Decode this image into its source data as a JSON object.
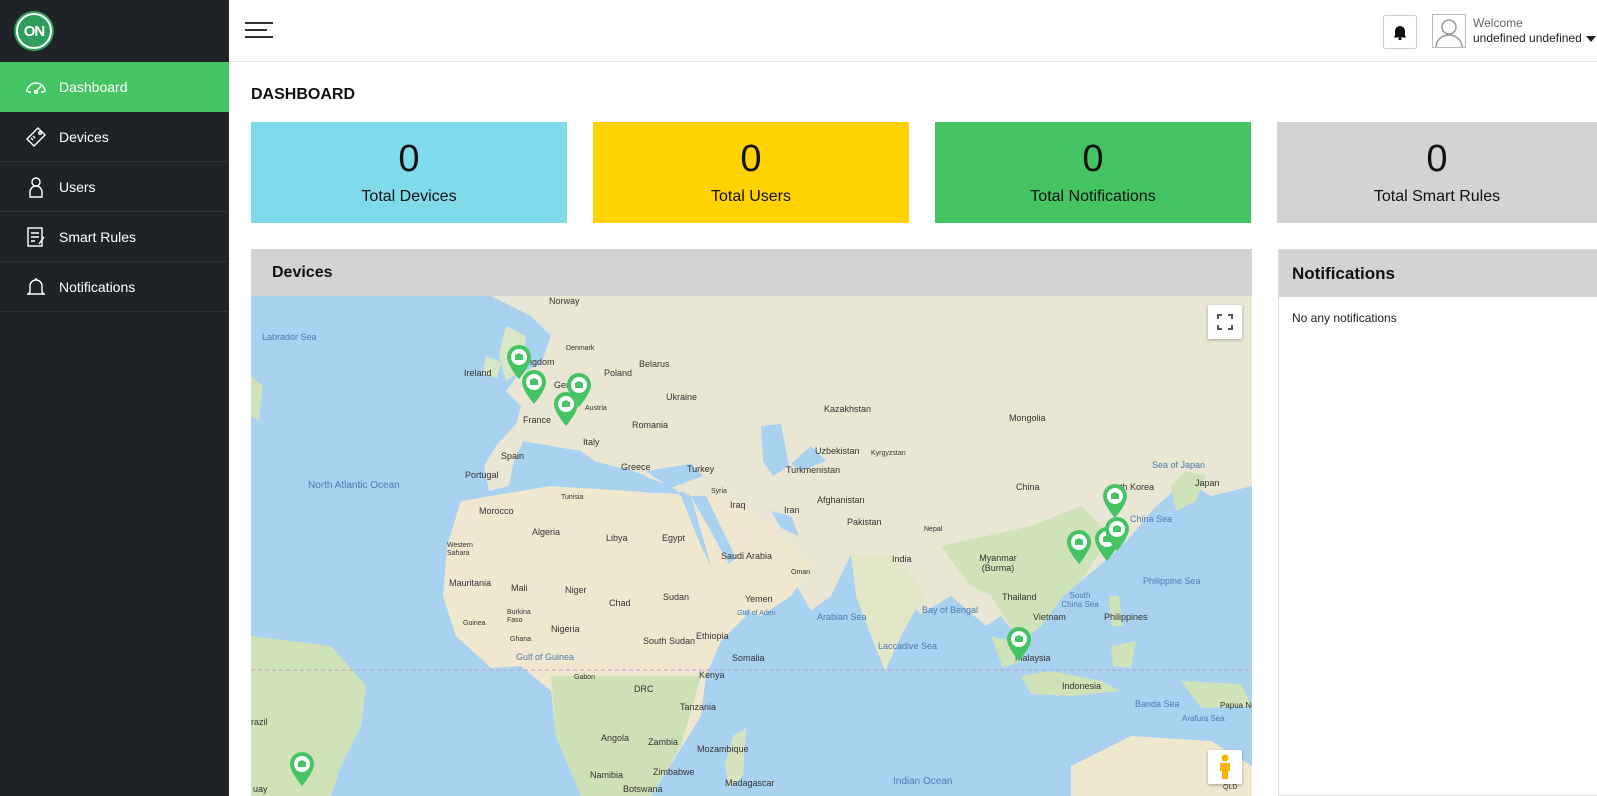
{
  "sidebar": {
    "logo_text": "ON",
    "items": [
      {
        "label": "Dashboard",
        "icon": "speedometer-icon",
        "active": true
      },
      {
        "label": "Devices",
        "icon": "tag-icon"
      },
      {
        "label": "Users",
        "icon": "user-icon"
      },
      {
        "label": "Smart Rules",
        "icon": "rules-icon"
      },
      {
        "label": "Notifications",
        "icon": "bell-icon"
      }
    ]
  },
  "header": {
    "welcome": "Welcome",
    "username": "undefined undefined"
  },
  "page": {
    "title": "DASHBOARD"
  },
  "stats": [
    {
      "value": "0",
      "label": "Total Devices",
      "color": "#7fdbea"
    },
    {
      "value": "0",
      "label": "Total Users",
      "color": "#ffd200"
    },
    {
      "value": "0",
      "label": "Total Notifications",
      "color": "#45c463"
    },
    {
      "value": "0",
      "label": "Total Smart Rules",
      "color": "#d3d3d3"
    }
  ],
  "devices_panel": {
    "title": "Devices",
    "map_labels": {
      "norway": "Norway",
      "labrador_sea": "Labrador Sea",
      "denmark": "Denmark",
      "belarus": "Belarus",
      "ireland": "Ireland",
      "united_kingdom": "Kingdom",
      "germany": "Germ",
      "poland": "Poland",
      "austria": "Austria",
      "ukraine": "Ukraine",
      "france": "France",
      "romania": "Romania",
      "italy": "Italy",
      "kazakhstan": "Kazakhstan",
      "mongolia": "Mongolia",
      "spain": "Spain",
      "portugal": "Portugal",
      "greece": "Greece",
      "turkey": "Turkey",
      "uzbekistan": "Uzbekistan",
      "kyrgyzstan": "Kyrgyzstan",
      "turkmenistan": "Turkmenistan",
      "sea_of_japan": "Sea of Japan",
      "japan": "Japan",
      "north_atlantic": "North Atlantic Ocean",
      "tunisia": "Tunisia",
      "syria": "Syria",
      "china": "China",
      "south_korea": "uth Korea",
      "iraq": "Iraq",
      "afghanistan": "Afghanistan",
      "morocco": "Morocco",
      "iran": "Iran",
      "east_china_sea": "China Sea",
      "pakistan": "Pakistan",
      "algeria": "Algeria",
      "libya": "Libya",
      "egypt": "Egypt",
      "nepal": "Nepal",
      "western_sahara": "Western Sahara",
      "saudi_arabia": "Saudi Arabia",
      "india": "India",
      "oman": "Oman",
      "myanmar": "Myanmar (Burma)",
      "philippine_sea": "Philippine Sea",
      "mauritania": "Mauritania",
      "mali": "Mali",
      "niger": "Niger",
      "yemen": "Yemen",
      "sudan": "Sudan",
      "chad": "Chad",
      "thailand": "Thailand",
      "south_china_sea": "South China Sea",
      "gulf_of_aden": "Gulf of Aden",
      "arabian_sea": "Arabian Sea",
      "bay_of_bengal": "Bay of Bengal",
      "burkina_faso": "Burkina Faso",
      "vietnam": "Vietnam",
      "philippines": "Philippines",
      "guinea": "Guinea",
      "nigeria": "Nigeria",
      "ghana": "Ghana",
      "ethiopia": "Ethiopia",
      "south_sudan": "South Sudan",
      "laccadive_sea": "Laccadive Sea",
      "gulf_of_guinea": "Gulf of Guinea",
      "somalia": "Somalia",
      "malaysia": "Malaysia",
      "gabon": "Gabon",
      "kenya": "Kenya",
      "drc": "DRC",
      "indonesia": "Indonesia",
      "banda_sea": "Banda Sea",
      "papua": "Papua New",
      "arafura_sea": "Arafura Sea",
      "tanzania": "Tanzania",
      "angola": "Angola",
      "zambia": "Zambia",
      "mozambique": "Mozambique",
      "namibia": "Namibia",
      "zimbabwe": "Zimbabwe",
      "madagascar": "Madagascar",
      "botswana": "Botswana",
      "indian_ocean": "Indian Ocean",
      "brazil": "razil",
      "qld": "QLD",
      "uay": "uay"
    }
  },
  "notifications_panel": {
    "title": "Notifications",
    "empty_text": "No any notifications"
  },
  "colors": {
    "sidebar_bg": "#1f2328",
    "accent": "#45c463",
    "map_water": "#a9d2f0",
    "map_land": "#e9e6d4",
    "marker": "#45c463"
  }
}
